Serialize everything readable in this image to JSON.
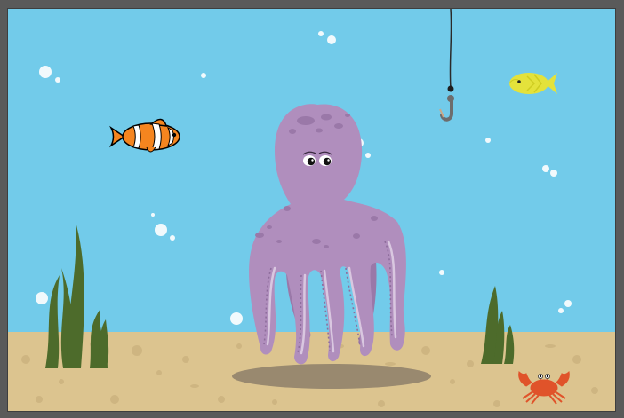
{
  "scene": {
    "colors": {
      "frame": "#5a5a5a",
      "water": "#72cbea",
      "sand": "#dcc48f",
      "sand_spots": "#cbb27e",
      "octopus": "#b08ebd",
      "octopus_dark": "#9a78a8",
      "seaweed": "#4d6b2b",
      "clownfish": "#f5851f",
      "yellow_fish": "#e4e23b",
      "crab": "#e0532a",
      "hook": "#6d6d6d",
      "line": "#2a2a2a"
    },
    "elements": [
      {
        "name": "octopus",
        "icon": "octopus-icon",
        "interactable": true
      },
      {
        "name": "clownfish",
        "icon": "clownfish-icon",
        "interactable": true
      },
      {
        "name": "yellow-fish",
        "icon": "yellow-fish-icon",
        "interactable": true
      },
      {
        "name": "crab",
        "icon": "crab-icon",
        "interactable": true
      },
      {
        "name": "fishing-hook",
        "icon": "fishing-hook-icon",
        "interactable": true
      },
      {
        "name": "seaweed-left",
        "icon": "seaweed-icon",
        "interactable": false
      },
      {
        "name": "seaweed-right",
        "icon": "seaweed-icon",
        "interactable": false
      },
      {
        "name": "bubbles",
        "icon": "bubble-icon",
        "interactable": false
      }
    ]
  }
}
